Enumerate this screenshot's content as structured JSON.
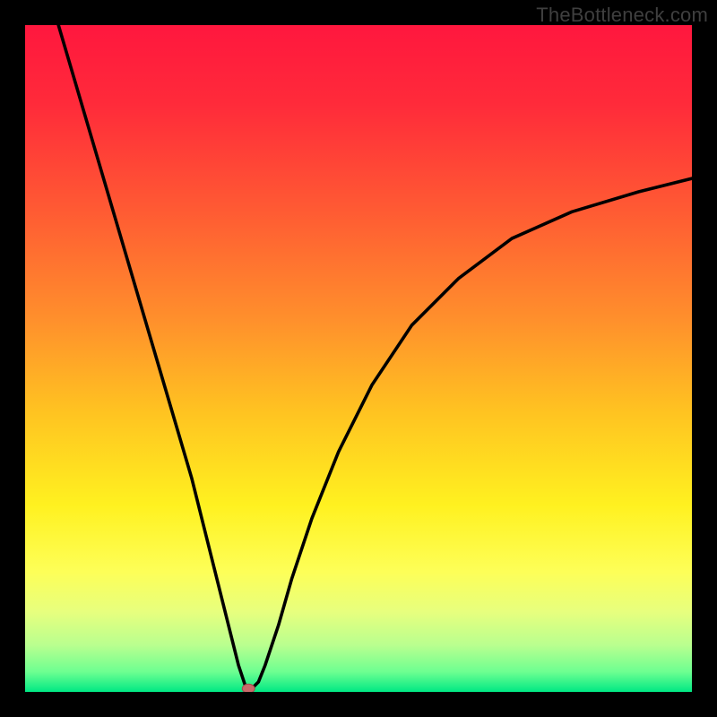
{
  "watermark": "TheBottleneck.com",
  "chart_data": {
    "type": "line",
    "title": "",
    "xlabel": "",
    "ylabel": "",
    "xlim": [
      0,
      100
    ],
    "ylim": [
      0,
      100
    ],
    "grid": false,
    "series": [
      {
        "name": "curve",
        "x": [
          5,
          10,
          15,
          20,
          25,
          28,
          30,
          31,
          32,
          33,
          34,
          35,
          36,
          38,
          40,
          43,
          47,
          52,
          58,
          65,
          73,
          82,
          92,
          100
        ],
        "y": [
          100,
          83,
          66,
          49,
          32,
          20,
          12,
          8,
          4,
          1,
          0.5,
          1.5,
          4,
          10,
          17,
          26,
          36,
          46,
          55,
          62,
          68,
          72,
          75,
          77
        ]
      }
    ],
    "marker": {
      "x": 33.5,
      "y": 0.5
    },
    "gradient_stops": [
      {
        "offset": 0.0,
        "color": "#ff173e"
      },
      {
        "offset": 0.12,
        "color": "#ff2b3a"
      },
      {
        "offset": 0.28,
        "color": "#ff5b33"
      },
      {
        "offset": 0.44,
        "color": "#ff8f2c"
      },
      {
        "offset": 0.58,
        "color": "#ffc321"
      },
      {
        "offset": 0.72,
        "color": "#fff120"
      },
      {
        "offset": 0.82,
        "color": "#fdff58"
      },
      {
        "offset": 0.88,
        "color": "#e7ff7e"
      },
      {
        "offset": 0.93,
        "color": "#b9ff8f"
      },
      {
        "offset": 0.97,
        "color": "#6dff91"
      },
      {
        "offset": 1.0,
        "color": "#00e884"
      }
    ]
  }
}
